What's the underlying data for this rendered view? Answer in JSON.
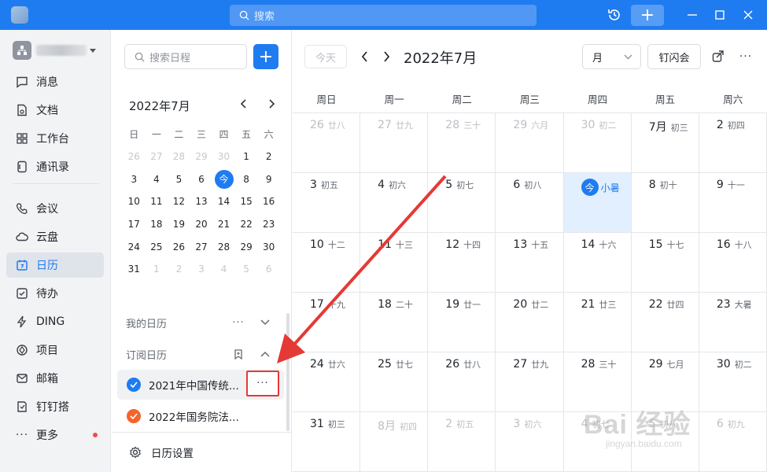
{
  "titlebar": {
    "search_placeholder": "搜索",
    "colors": {
      "bar": "#1f7cf0"
    }
  },
  "nav": {
    "items": [
      {
        "label": "消息",
        "icon": "message-icon"
      },
      {
        "label": "文档",
        "icon": "document-icon"
      },
      {
        "label": "工作台",
        "icon": "grid-icon"
      },
      {
        "label": "通讯录",
        "icon": "contacts-icon"
      },
      {
        "label": "会议",
        "icon": "phone-icon"
      },
      {
        "label": "云盘",
        "icon": "cloud-icon"
      },
      {
        "label": "日历",
        "icon": "calendar-icon",
        "active": true
      },
      {
        "label": "待办",
        "icon": "checkbox-icon"
      },
      {
        "label": "DING",
        "icon": "lightning-icon"
      },
      {
        "label": "项目",
        "icon": "project-icon"
      },
      {
        "label": "邮箱",
        "icon": "mail-icon"
      },
      {
        "label": "钉钉搭",
        "icon": "build-icon"
      },
      {
        "label": "更多",
        "icon": "more-icon"
      }
    ]
  },
  "panel": {
    "search_placeholder": "搜索日程",
    "mini_title": "2022年7月",
    "weekdays": [
      "日",
      "一",
      "二",
      "三",
      "四",
      "五",
      "六"
    ],
    "today_label": "今",
    "my_calendars_label": "我的日历",
    "subscribed_label": "订阅日历",
    "subscriptions": [
      {
        "name": "2021年中国传统...",
        "color": "#1f7cf0"
      },
      {
        "name": "2022年国务院法...",
        "color": "#f5642a"
      }
    ],
    "more_label": "···",
    "settings_label": "日历设置"
  },
  "main": {
    "today_button": "今天",
    "month_title": "2022年7月",
    "view_select": "月",
    "flash_button": "钉闪会",
    "week_headers": [
      "周日",
      "周一",
      "周二",
      "周三",
      "周四",
      "周五",
      "周六"
    ],
    "today_label": "今",
    "weeks": [
      [
        [
          "26",
          "廿八",
          true
        ],
        [
          "27",
          "廿九",
          true
        ],
        [
          "28",
          "三十",
          true
        ],
        [
          "29",
          "六月",
          true
        ],
        [
          "30",
          "初二",
          true
        ],
        [
          "7月",
          "初三",
          false
        ],
        [
          "2",
          "初四",
          false
        ]
      ],
      [
        [
          "3",
          "初五",
          false
        ],
        [
          "4",
          "初六",
          false
        ],
        [
          "5",
          "初七",
          false
        ],
        [
          "6",
          "初八",
          false
        ],
        [
          "今",
          "小暑",
          false,
          true
        ],
        [
          "8",
          "初十",
          false
        ],
        [
          "9",
          "十一",
          false
        ]
      ],
      [
        [
          "10",
          "十二",
          false
        ],
        [
          "11",
          "十三",
          false
        ],
        [
          "12",
          "十四",
          false
        ],
        [
          "13",
          "十五",
          false
        ],
        [
          "14",
          "十六",
          false
        ],
        [
          "15",
          "十七",
          false
        ],
        [
          "16",
          "十八",
          false
        ]
      ],
      [
        [
          "17",
          "十九",
          false
        ],
        [
          "18",
          "二十",
          false
        ],
        [
          "19",
          "廿一",
          false
        ],
        [
          "20",
          "廿二",
          false
        ],
        [
          "21",
          "廿三",
          false
        ],
        [
          "22",
          "廿四",
          false
        ],
        [
          "23",
          "大暑",
          false
        ]
      ],
      [
        [
          "24",
          "廿六",
          false
        ],
        [
          "25",
          "廿七",
          false
        ],
        [
          "26",
          "廿八",
          false
        ],
        [
          "27",
          "廿九",
          false
        ],
        [
          "28",
          "三十",
          false
        ],
        [
          "29",
          "七月",
          false
        ],
        [
          "30",
          "初二",
          false
        ]
      ],
      [
        [
          "31",
          "初三",
          false
        ],
        [
          "8月",
          "初四",
          true
        ],
        [
          "2",
          "初五",
          true
        ],
        [
          "3",
          "初六",
          true
        ],
        [
          "4",
          "初七",
          true
        ],
        [
          "5",
          "初八",
          true
        ],
        [
          "6",
          "初九",
          true
        ]
      ]
    ]
  },
  "mini_days": [
    [
      "26",
      true
    ],
    [
      "27",
      true
    ],
    [
      "28",
      true
    ],
    [
      "29",
      true
    ],
    [
      "30",
      true
    ],
    [
      "1",
      false
    ],
    [
      "2",
      false
    ],
    [
      "3",
      false
    ],
    [
      "4",
      false
    ],
    [
      "5",
      false
    ],
    [
      "6",
      false
    ],
    [
      "今",
      false,
      true
    ],
    [
      "8",
      false
    ],
    [
      "9",
      false
    ],
    [
      "10",
      false
    ],
    [
      "11",
      false
    ],
    [
      "12",
      false
    ],
    [
      "13",
      false
    ],
    [
      "14",
      false
    ],
    [
      "15",
      false
    ],
    [
      "16",
      false
    ],
    [
      "17",
      false
    ],
    [
      "18",
      false
    ],
    [
      "19",
      false
    ],
    [
      "20",
      false
    ],
    [
      "21",
      false
    ],
    [
      "22",
      false
    ],
    [
      "23",
      false
    ],
    [
      "24",
      false
    ],
    [
      "25",
      false
    ],
    [
      "26",
      false
    ],
    [
      "27",
      false
    ],
    [
      "28",
      false
    ],
    [
      "29",
      false
    ],
    [
      "30",
      false
    ],
    [
      "31",
      false
    ],
    [
      "1",
      true
    ],
    [
      "2",
      true
    ],
    [
      "3",
      true
    ],
    [
      "4",
      true
    ],
    [
      "5",
      true
    ],
    [
      "6",
      true
    ]
  ],
  "watermark": {
    "line1": "Bai 经验",
    "line2": "jingyan.baidu.com"
  }
}
